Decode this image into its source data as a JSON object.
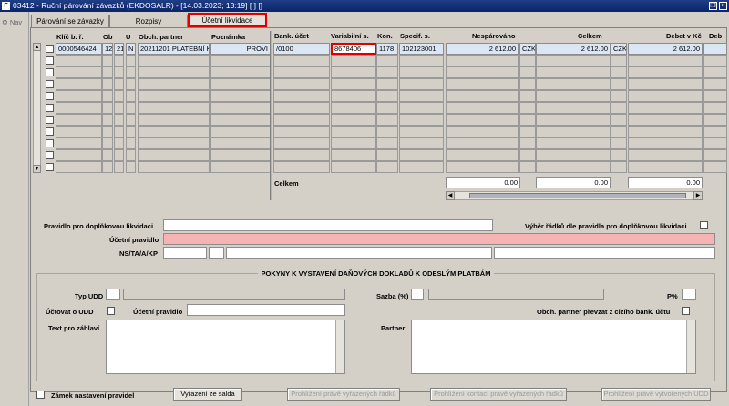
{
  "window": {
    "title": "03412 - Ruční párování závazků (EKDOSALR) - [14.03.2023; 13:19] [ ] []",
    "app_icon": "app-icon",
    "controls": [
      "restore-icon",
      "close-icon"
    ]
  },
  "nav": {
    "label": "Nav"
  },
  "tabs": [
    {
      "label": "Párování se závazky"
    },
    {
      "label": "Rozpisy"
    },
    {
      "label": "Účetní likvidace"
    }
  ],
  "left_grid": {
    "headers": {
      "klic": "Klíč b. ř.",
      "ob": "Ob",
      "u": "U",
      "partner": "Obch. partner",
      "poznamka": "Poznámka"
    },
    "row1": {
      "klic": "0000546424",
      "ob": "12",
      "u": "21",
      "n": "N",
      "partner": "20211201 PLATEBNÍ K",
      "poznamka": "PROVI"
    }
  },
  "right_grid": {
    "headers": {
      "bank": "Bank. účet",
      "var": "Variabilní s.",
      "kon": "Kon.",
      "spec": "Specif. s.",
      "nespar": "Nespárováno",
      "celkem": "Celkem",
      "debet": "Debet v Kč",
      "deb": "Deb"
    },
    "row1": {
      "bank": "/0100",
      "var": "8678406",
      "kon": "1178",
      "spec": "102123001",
      "nespar": "2 612.00",
      "cur1": "CZK",
      "celkem": "2 612.00",
      "cur2": "CZK",
      "debet": "2 612.00"
    },
    "totals": {
      "label": "Celkem",
      "nespar": "0.00",
      "celkem": "0.00",
      "debet": "0.00"
    }
  },
  "form": {
    "pravidlo_label": "Pravidlo pro doplňkovou likvidaci",
    "vyber_label": "Výběr řádků dle pravidla pro doplňkovou likvidaci",
    "ucetni_label": "Účetní pravidlo",
    "nsta_label": "NS/TA/A/KP"
  },
  "pokyny": {
    "title": "POKYNY K VYSTAVENÍ DAŇOVÝCH DOKLADŮ K ODESLÝM PLATBÁM",
    "typ_udd": "Typ UDD",
    "sazba": "Sazba (%)",
    "pct": "P%",
    "uctovat": "Účtovat o UDD",
    "ucetni": "Účetní pravidlo",
    "partner_prevzat": "Obch. partner převzat z cizího bank. účtu",
    "text_zahlavi": "Text pro záhlaví",
    "partner": "Partner"
  },
  "bottom": {
    "zamek": "Zámek nastavení pravidel",
    "vyrazeni": "Vyřazení ze salda",
    "prohl1": "Prohlížení právě vyřazených řádků",
    "prohl2": "Prohlížení kontací právě vyřazených řádků",
    "prohl3": "Prohlížení právě vytvořených UDD"
  },
  "colors": {
    "highlight_red": "#e00000",
    "required_pink": "#f5b3b3",
    "selected_row": "#dbe6f5"
  }
}
